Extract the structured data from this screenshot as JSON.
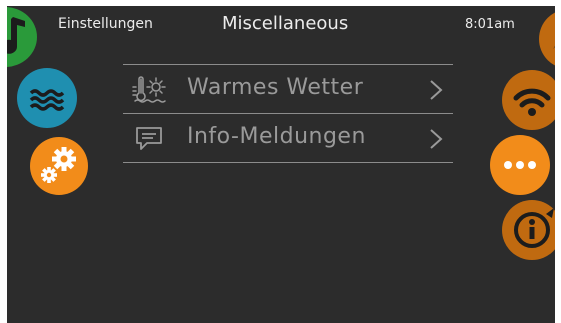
{
  "header": {
    "back_label": "Einstellungen",
    "title": "Miscellaneous",
    "time": "8:01am"
  },
  "menu": {
    "items": [
      {
        "label": "Warmes Wetter",
        "icon": "thermometer-sun-icon"
      },
      {
        "label": "Info-Meldungen",
        "icon": "message-icon"
      }
    ]
  },
  "left_nav": [
    "music-icon",
    "water-icon",
    "settings-gears-icon"
  ],
  "right_nav": [
    "lights-icon",
    "wifi-icon",
    "more-dots-icon",
    "info-icon"
  ],
  "colors": {
    "background": "#2c2c2c",
    "green": "#2a9a3a",
    "blue": "#1f8fb0",
    "orange": "#f28c1a",
    "dark_orange": "#c06a10",
    "text": "#ececec",
    "menu_text": "#9a9a9a"
  }
}
